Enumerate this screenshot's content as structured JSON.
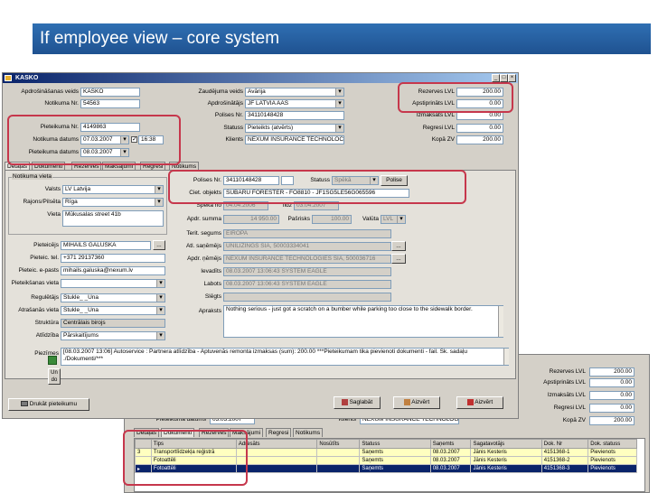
{
  "slide_title": "If employee view – core system",
  "back_window": {
    "header": {
      "rezerves_lbl": "Rezerves LVL",
      "rezerves_val": "200.00",
      "apstiprinats_lbl": "Apstiprināts LVL",
      "apstiprinats_val": "0.00",
      "izmaksats_lbl": "Izmaksāts LVL",
      "izmaksats_val": "0.00",
      "regresi_lbl": "Regresi LVL",
      "regresi_val": "0.00",
      "kopa_lbl": "Kopā ZV",
      "kopa_val": "200.00"
    },
    "pieteikuma_datums_lbl": "Pieteikuma datums",
    "pieteikuma_datums_val": "03.03.2007",
    "klients_lbl": "Klients",
    "klients_val": "NEXUM INSURANCE TECHNOLOG",
    "tabs": [
      "Detaļas",
      "Dokumenti",
      "Rezerves",
      "Maksājumi",
      "Regresi",
      "Notikums"
    ],
    "columns": [
      "Tips",
      "Adresāts",
      "Nosūtīts",
      "Statuss",
      "Saņemts",
      "Sagatavotājs",
      "Dok. Nr",
      "Dok. statuss"
    ],
    "rows": [
      {
        "n": "3",
        "tips": "Transportlīdzekļa reģistrā",
        "statuss": "Saņemts",
        "sanemts": "08.03.2007",
        "sagat": "Jānis Kesteris",
        "dok": "4151368-1",
        "dok_statuss": "Pievienots"
      },
      {
        "n": "",
        "tips": "Fotoattēli",
        "statuss": "Saņemts",
        "sanemts": "08.03.2007",
        "sagat": "Jānis Kesteris",
        "dok": "4151368-2",
        "dok_statuss": "Pievienots"
      },
      {
        "n": "",
        "tips": "Fotoattēli",
        "statuss": "Saņemts",
        "sanemts": "08.03.2007",
        "sagat": "Jānis Kesteris",
        "dok": "4151368-3",
        "dok_statuss": "Pievienots"
      }
    ]
  },
  "window": {
    "title": "KASKO",
    "apdrosinasanas_veids_lbl": "Apdrošināšanas veids",
    "apdrosinasanas_veids_val": "KASKO",
    "notikuma_nr_lbl": "Notikuma Nr.",
    "notikuma_nr_val": "54563",
    "pieteikuma_nr_lbl": "Pieteikuma Nr.",
    "pieteikuma_nr_val": "4149863",
    "notikuma_datums_lbl": "Notikuma datums",
    "notikuma_datums_val": "07.03.2007",
    "notikuma_laiks_val": "16:38",
    "pieteikuma_datums_lbl": "Pieteikuma datums",
    "pieteikuma_datums_val": "08.03.2007",
    "zaudejuma_veids_lbl": "Zaudējuma veids",
    "zaudejuma_veids_val": "Avārija",
    "apdrosinatajs_lbl": "Apdrošinātājs",
    "apdrosinatajs_val": "JF LATVIA AAS",
    "polises_nr_lbl": "Polises Nr.",
    "polises_nr_val": "34110148428",
    "statuss_lbl": "Statuss",
    "statuss_val": "Pieteikts (atvērts)",
    "klients_lbl": "Klients",
    "klients_val": "NEXUM INSURANCE TECHNOLOC",
    "rezerves_lbl": "Rezerves LVL",
    "rezerves_val": "200.00",
    "apstiprinats_lbl": "Apstiprināts LVL",
    "apstiprinats_val": "0.00",
    "izmaksats_lbl": "Izmaksāts LVL",
    "izmaksats_val": "0.00",
    "regresi_lbl": "Regresi LVL",
    "regresi_val": "0.00",
    "kopa_lbl": "Kopā ZV",
    "kopa_val": "200.00",
    "tabs": [
      "Detaļas",
      "Dokumenti",
      "Rezerves",
      "Maksājumi",
      "Regresi",
      "Notikums"
    ],
    "location_group": "Notikuma vieta",
    "valsts_lbl": "Valsts",
    "valsts_val": "LV Latvija",
    "rajons_lbl": "Rajons/Pilsēta",
    "rajons_val": "Rīga",
    "vieta_lbl": "Vieta",
    "vieta_val": "Mūkusalas street 41b",
    "det_polises_nr_lbl": "Polises Nr.",
    "det_polises_nr_val": "34110148428",
    "det_statuss_lbl": "Statuss",
    "det_statuss_val": "Spēkā",
    "polise_btn": "Polise",
    "ciet_objekts_lbl": "Ciet. objekts",
    "ciet_objekts_val": "SUBARU FORESTER  - FO8810  - JF1SG5LE56G065596",
    "speka_no_lbl": "Spēkā no",
    "speka_no_val": "04.04.2006",
    "lidz_lbl": "līdz",
    "lidz_val": "03.04.2007",
    "apdr_summa_lbl": "Apdr. summa",
    "apdr_summa_val": "14 950.00",
    "pasrisks_lbl": "Pašrisks",
    "pasrisks_val": "100.00",
    "valuta_lbl": "Valūta",
    "valuta_val": "LVL",
    "terit_segums_lbl": "Terit. segums",
    "terit_segums_val": "EIROPA",
    "ati_sagemejs_lbl": "Atl. saņēmējs",
    "ati_sagemejs_val": "UNILĪZINGS SIA, 50003334041",
    "apdr_nemejs_lbl": "Apdr. ņēmējs",
    "apdr_nemejs_val": "NEXUM INSURANCE TECHNOLOGIES SIA, 500036716",
    "ievadits_lbl": "Ievadīts",
    "ievadits_val": "08.03.2007 13:06:43 SYSTEM EAGLE",
    "labots_lbl": "Labots",
    "labots_val": "08.03.2007 13:06:43 SYSTEM EAGLE",
    "slegts_lbl": "Slēgts",
    "slegts_val": "",
    "apraksts_lbl": "Apraksts",
    "apraksts_val": "Nothing serious - just got a scratch on a bumber while parking too close to the sidewalk border.",
    "pieteicejs_lbl": "Pieteicējs",
    "pieteicejs_val": "MIHAILS GALUŠKA",
    "pieteic_tel_lbl": "Pieteic. tel.",
    "pieteic_tel_val": "+371 29137360",
    "pieteic_epasts_lbl": "Pieteic. e-pasts",
    "pieteic_epasts_val": "mihails.galuska@nexum.lv",
    "pieteiksanas_vieta_lbl": "Pieteikšanas vieta",
    "pieteiksanas_vieta_val": "",
    "regulatajs_lbl": "Regulētājs",
    "regulatajs_val": "Stukle_ _Ūna",
    "atrisinams_lbl": "Atrašanās vieta",
    "atrisinams_val": "Stukle_ _Ūna",
    "struktura_lbl": "Struktūra",
    "struktura_val": "Centrālais birojs",
    "atlidziba_lbl": "Atlīdzība",
    "atlidziba_val": "Pārskaitījums",
    "piezimes_lbl": "Piezīmes",
    "piezimes_val": "[08.03.2007 13:06] Autoservice : Partnera atlīdzība - Aptuvenās remonta izmaksas (sum): 200.00 ***Pieteikumam tika pievienoti dokumenti - fail. Sk. sadaļu ./Dokumenti/***",
    "undo_lbl": "Un do",
    "druka_btn": "Drukāt pieteikumu",
    "saglabat_btn": "Saglabāt",
    "aizvert_btn": "Aizvērt",
    "aizvert_btn2": "Aizvērt",
    "colors": {
      "highlight": "#c6374c",
      "title_bar": "#0a246a",
      "slide_banner": "#2f6fb3"
    }
  }
}
